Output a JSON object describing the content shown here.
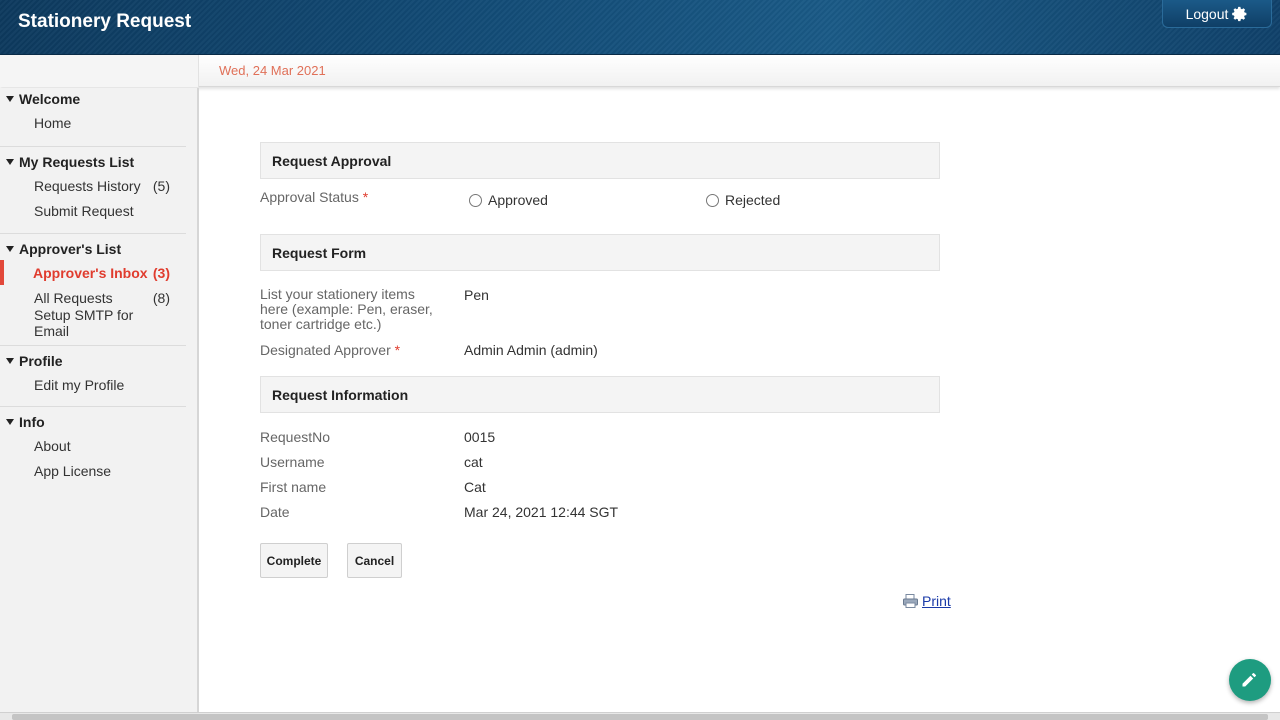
{
  "app": {
    "title": "Stationery Request",
    "logout_label": "Logout"
  },
  "datebar": {
    "date": "Wed, 24 Mar 2021"
  },
  "sidebar": {
    "sections": [
      {
        "title": "Welcome",
        "items": [
          {
            "label": "Home",
            "count": ""
          }
        ]
      },
      {
        "title": "My Requests List",
        "items": [
          {
            "label": "Requests History",
            "count": "(5)"
          },
          {
            "label": "Submit Request",
            "count": ""
          }
        ]
      },
      {
        "title": "Approver's List",
        "items": [
          {
            "label": "Approver's Inbox",
            "count": "(3)",
            "active": true
          },
          {
            "label": "All Requests",
            "count": "(8)"
          },
          {
            "label": "Setup SMTP for Email",
            "count": ""
          }
        ]
      },
      {
        "title": "Profile",
        "items": [
          {
            "label": "Edit my Profile",
            "count": ""
          }
        ]
      },
      {
        "title": "Info",
        "items": [
          {
            "label": "About",
            "count": ""
          },
          {
            "label": "App License",
            "count": ""
          }
        ]
      }
    ]
  },
  "form": {
    "approval": {
      "heading": "Request Approval",
      "status_label": "Approval Status",
      "required_mark": "*",
      "options": [
        "Approved",
        "Rejected"
      ]
    },
    "request_form": {
      "heading": "Request Form",
      "items_label": "List your stationery items here (example: Pen, eraser, toner cartridge etc.)",
      "items_value": "Pen",
      "approver_label": "Designated Approver",
      "approver_required": "*",
      "approver_value": "Admin Admin (admin)"
    },
    "info": {
      "heading": "Request Information",
      "fields": [
        {
          "label": "RequestNo",
          "value": "0015"
        },
        {
          "label": "Username",
          "value": "cat"
        },
        {
          "label": "First name",
          "value": "Cat"
        },
        {
          "label": "Date",
          "value": "Mar 24, 2021 12:44 SGT"
        }
      ]
    },
    "buttons": {
      "complete": "Complete",
      "cancel": "Cancel"
    },
    "print_label": "Print"
  },
  "colors": {
    "header": "#124a75",
    "accent_red": "#e03c2e",
    "fab": "#1e9c80",
    "link": "#1a3aa8"
  }
}
